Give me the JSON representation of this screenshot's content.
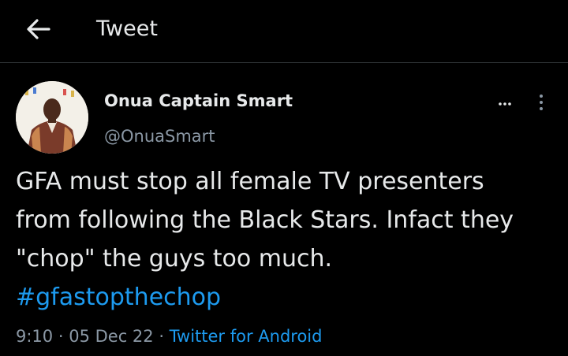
{
  "header": {
    "title": "Tweet",
    "back_icon": "arrow-left-icon"
  },
  "author": {
    "display_name": "Onua Captain Smart",
    "handle": "@OnuaSmart",
    "avatar": "avatar-photo"
  },
  "tweet": {
    "line1": "GFA must stop all female TV presenters",
    "line2": "from following the Black Stars. Infact they",
    "line3": "\"chop\" the guys too much.",
    "hashtag": "#gfastopthechop"
  },
  "meta": {
    "time": "9:10",
    "sep1": " · ",
    "date": "05 Dec 22",
    "sep2": " · ",
    "source": "Twitter for Android"
  },
  "colors": {
    "background": "#000000",
    "text": "#e7e9ea",
    "secondary": "#8b98a5",
    "link": "#1d9bf0"
  }
}
